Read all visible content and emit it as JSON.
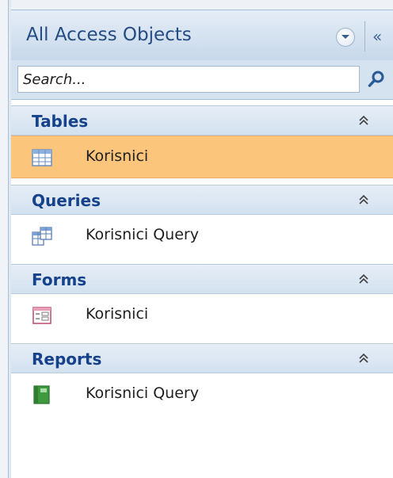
{
  "pane": {
    "title": "All Access Objects",
    "dropdown_icon": "dropdown-circle-icon",
    "collapse_label": "«"
  },
  "search": {
    "placeholder": "Search...",
    "value": "",
    "icon": "search-icon"
  },
  "groups": [
    {
      "label": "Tables",
      "icon": "collapse-chevron-icon",
      "items": [
        {
          "label": "Korisnici",
          "icon": "table-icon",
          "selected": true
        }
      ]
    },
    {
      "label": "Queries",
      "icon": "collapse-chevron-icon",
      "items": [
        {
          "label": "Korisnici Query",
          "icon": "query-icon",
          "selected": false
        }
      ]
    },
    {
      "label": "Forms",
      "icon": "collapse-chevron-icon",
      "items": [
        {
          "label": "Korisnici",
          "icon": "form-icon",
          "selected": false
        }
      ]
    },
    {
      "label": "Reports",
      "icon": "collapse-chevron-icon",
      "items": [
        {
          "label": "Korisnici Query",
          "icon": "report-icon",
          "selected": false
        }
      ]
    }
  ],
  "colors": {
    "title": "#254c82",
    "group_label": "#15428b",
    "selected_background": "#fcc57c"
  }
}
